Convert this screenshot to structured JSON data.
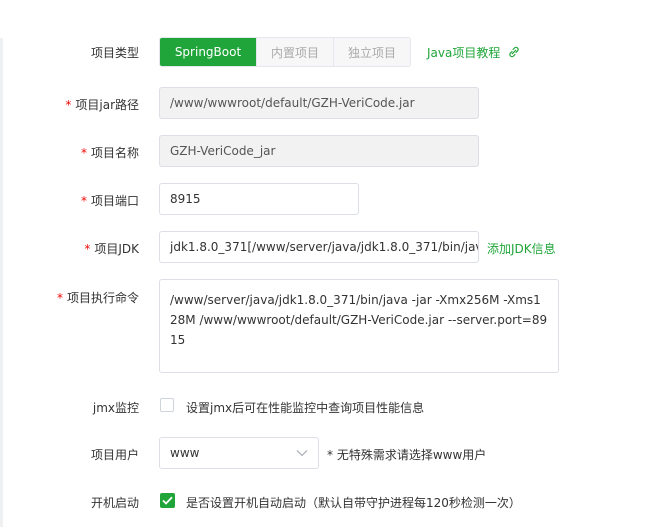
{
  "project_type": {
    "label": "项目类型",
    "tabs": [
      "SpringBoot",
      "内置项目",
      "独立项目"
    ],
    "active_index": 0,
    "tutorial_link": "Java项目教程",
    "tutorial_icon": "external-link-icon"
  },
  "jar_path": {
    "label": "项目jar路径",
    "value": "/www/wwwroot/default/GZH-VeriCode.jar",
    "required": "*"
  },
  "project_name": {
    "label": "项目名称",
    "value": "GZH-VeriCode_jar",
    "required": "*"
  },
  "project_port": {
    "label": "项目端口",
    "value": "8915",
    "required": "*"
  },
  "project_jdk": {
    "label": "项目JDK",
    "value": "jdk1.8.0_371[/www/server/java/jdk1.8.0_371/bin/jav",
    "required": "*",
    "add_link": "添加JDK信息"
  },
  "exec_command": {
    "label": "项目执行命令",
    "value": "/www/server/java/jdk1.8.0_371/bin/java  -jar -Xmx256M -Xms128M  /www/wwwroot/default/GZH-VeriCode.jar --server.port=8915",
    "required": "*"
  },
  "jmx": {
    "label": "jmx监控",
    "hint": "设置jmx后可在性能监控中查询项目性能信息",
    "checked": false
  },
  "project_user": {
    "label": "项目用户",
    "value": "www",
    "hint": "* 无特殊需求请选择www用户"
  },
  "autostart": {
    "label": "开机启动",
    "hint": "是否设置开机自动启动（默认自带守护进程每120秒检测一次）",
    "checked": true
  },
  "colors": {
    "accent": "#20a53a",
    "required": "#ef0808",
    "border": "#dcdfe6"
  }
}
